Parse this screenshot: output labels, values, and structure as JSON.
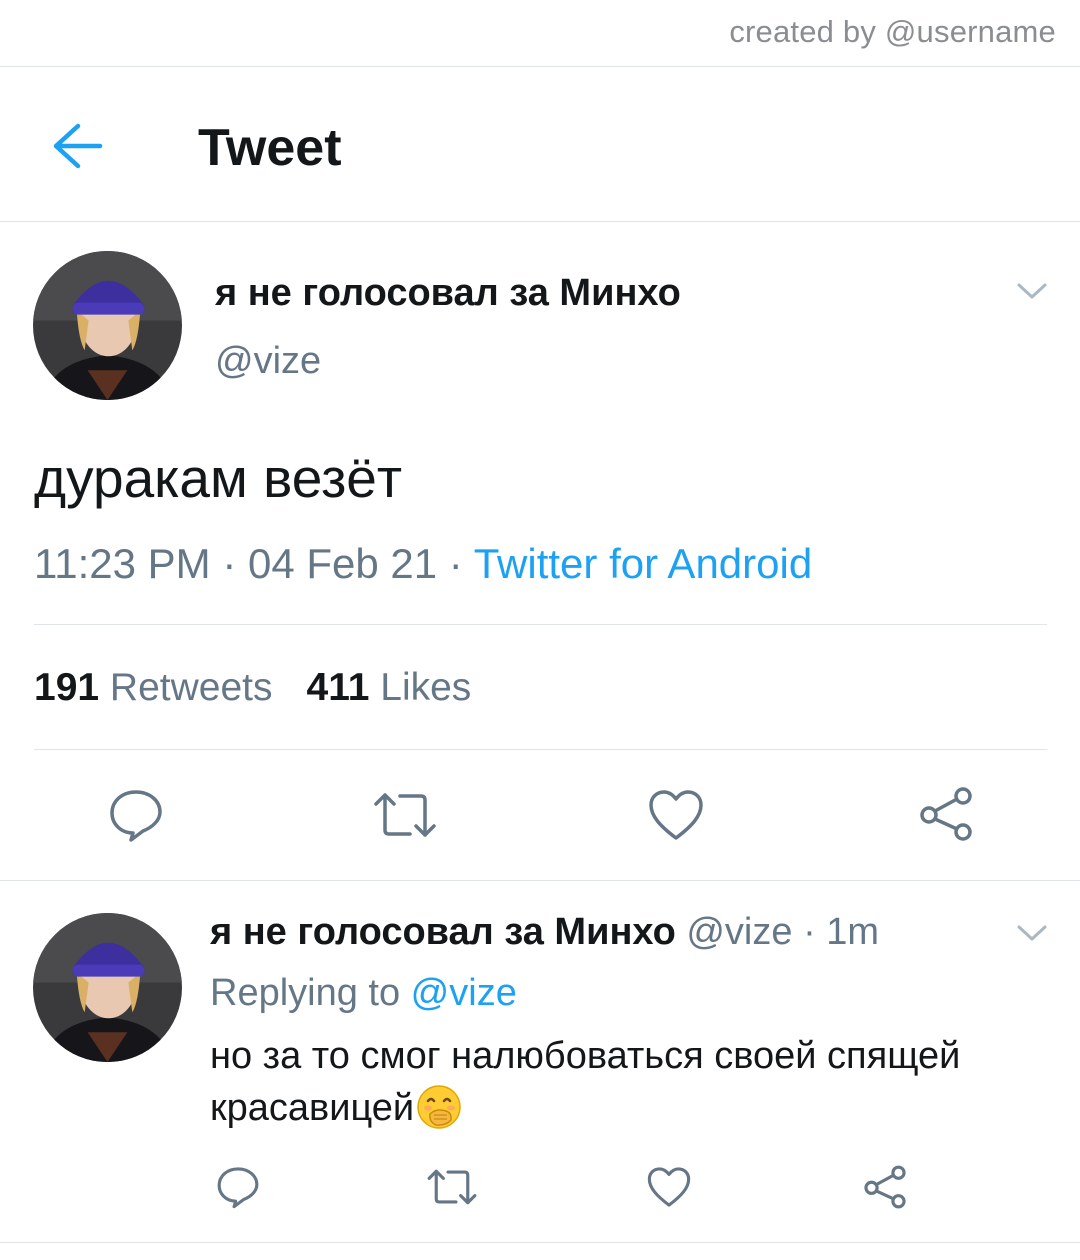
{
  "watermark": "created by @username",
  "header": {
    "title": "Tweet",
    "back_icon": "arrow-left-icon"
  },
  "main_tweet": {
    "display_name": "я не голосовал за Минхо",
    "handle": "@vize",
    "text": "дуракам везёт",
    "time": "11:23 PM",
    "date": "04 Feb 21",
    "separator": " · ",
    "source": "Twitter for Android",
    "retweets_count": "191",
    "retweets_label": "Retweets",
    "likes_count": "411",
    "likes_label": "Likes",
    "actions": [
      "reply-icon",
      "retweet-icon",
      "like-icon",
      "share-icon"
    ]
  },
  "reply_tweet": {
    "display_name": "я не голосовал за Минхо",
    "handle": "@vize",
    "dot": " · ",
    "time_ago": "1m",
    "replying_prefix": "Replying to ",
    "replying_to": "@vize",
    "text": "но за то смог налюбоваться своей спящей красавицей",
    "emoji": "face-with-hand-over-mouth-emoji",
    "actions": [
      "reply-icon",
      "retweet-icon",
      "like-icon",
      "share-icon"
    ]
  },
  "colors": {
    "accent": "#1da1f2",
    "text": "#14171a",
    "muted": "#657786",
    "divider": "#e1e5e8"
  }
}
